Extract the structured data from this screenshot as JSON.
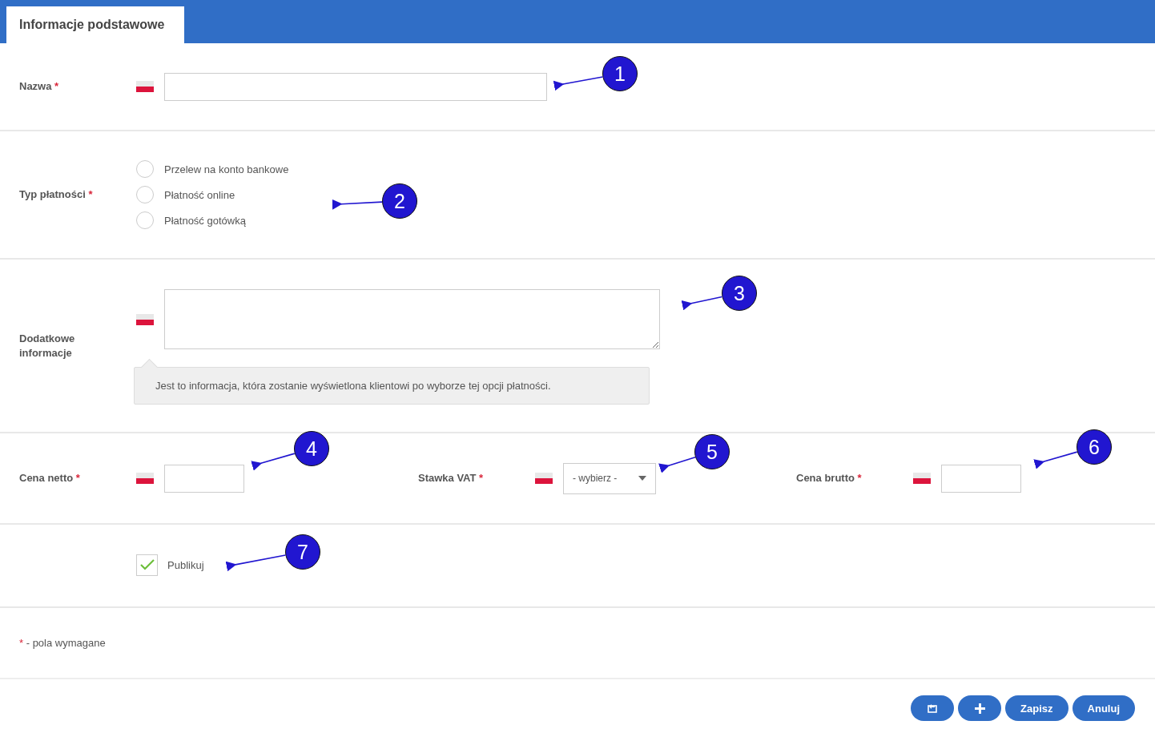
{
  "tabs": [
    {
      "label": "Informacje podstawowe",
      "selected": true
    }
  ],
  "name_field": {
    "label": "Nazwa",
    "mark": "*"
  },
  "payment_type": {
    "label": "Typ płatności",
    "mark": "*",
    "options": [
      {
        "label": "Przelew na konto bankowe",
        "selected": false
      },
      {
        "label": "Płatność online",
        "selected": false
      },
      {
        "label": "Płatność gotówką",
        "selected": false
      }
    ]
  },
  "extra_info": {
    "label": "Dodatkowe informacje",
    "hint": "Jest to informacja, która zostanie wyświetlona klientowi po wyborze tej opcji płatności."
  },
  "price_fields": [
    {
      "kind": "input",
      "label": "Cena netto",
      "mark": "*"
    },
    {
      "kind": "select",
      "label": "Stawka VAT",
      "mark": "*",
      "value": "- wybierz -"
    },
    {
      "kind": "input",
      "label": "Cena brutto",
      "mark": "*"
    }
  ],
  "publish": {
    "label": "Publikuj",
    "checked": true
  },
  "required_note": {
    "mark": "*",
    "text": "- pola wymagane"
  },
  "buttons": [
    {
      "kind": "back"
    },
    {
      "kind": "add"
    },
    {
      "kind": "text",
      "label": "Zapisz"
    },
    {
      "kind": "text",
      "label": "Anuluj"
    }
  ],
  "callouts": [
    "1",
    "2",
    "3",
    "4",
    "5",
    "6",
    "7"
  ]
}
